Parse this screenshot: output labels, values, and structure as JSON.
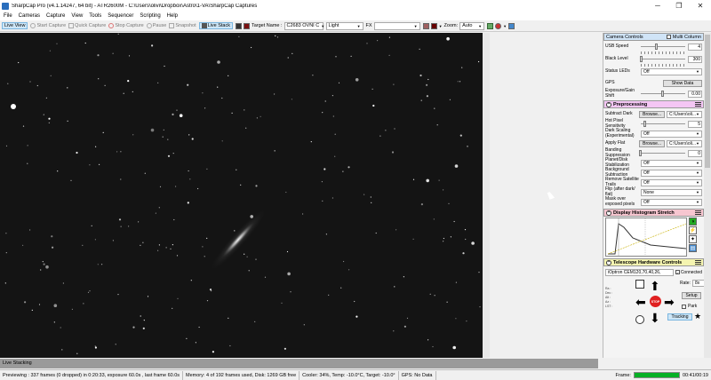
{
  "titlebar": {
    "title": "SharpCap Pro (v4.1.14247, 64 bit) - ATR2600M - C:\\Users\\olivi\\Dropbox\\Astro\\1-VA\\SharpCap Captures",
    "minimize": "─",
    "restore": "❐",
    "close": "✕"
  },
  "menu": [
    "File",
    "Cameras",
    "Capture",
    "View",
    "Tools",
    "Sequencer",
    "Scripting",
    "Help"
  ],
  "toolbar": {
    "live_view": "Live View",
    "start_capture": "Start Capture",
    "quick_capture": "Quick Capture",
    "stop_capture": "Stop Capture",
    "pause": "Pause",
    "snapshot": "Snapshot",
    "live_stack": "Live Stack",
    "target_label": "Target Name :",
    "target_value": "C2683 OVNI C",
    "frame_type": "Light",
    "fx_label": "FX",
    "fx_value": "",
    "zoom_label": "Zoom:",
    "zoom_value": "Auto"
  },
  "panel": {
    "camera_controls": {
      "title": "Camera Controls",
      "multi_column": "Multi Column",
      "usb_speed_label": "USB Speed",
      "usb_speed_value": "4",
      "usb_speed_level": 0.35,
      "black_level_label": "Black Level",
      "black_level_value": "300",
      "black_level_level": 0.02,
      "status_leds_label": "Status LEDs",
      "status_leds_value": "Off",
      "gps_label": "GPS",
      "gps_button": "Show Data",
      "exposure_gain_label": "Exposure/Gain Shift",
      "exposure_gain_value": "0.00",
      "exposure_gain_level": 0.5
    },
    "preprocessing": {
      "title": "Preprocessing",
      "subtract_dark_label": "Subtract Dark",
      "browse": "Browse...",
      "dark_path": "C:\\Users\\oli...",
      "hot_pixel_label": "Hot Pixel Sensitivity",
      "hot_pixel_value": "5",
      "hot_pixel_level": 0.1,
      "dark_scaling_label": "Dark Scaling (Experimental)",
      "dark_scaling_value": "Off",
      "apply_flat_label": "Apply Flat",
      "flat_path": "C:\\Users\\oli...",
      "banding_label": "Banding Suppression",
      "banding_value": "0",
      "banding_level": 0.0,
      "planet_label": "Planet/Disk Stabilization",
      "planet_value": "Off",
      "background_label": "Background Subtraction",
      "background_value": "Off",
      "satellite_label": "Remove Satellite Trails",
      "satellite_value": "Off",
      "flip_label": "Flip (after dark/ flat)",
      "flip_value": "None",
      "mask_label": "Mask over exposed pixels",
      "mask_value": "Off"
    },
    "histogram": {
      "title": "Display Histogram Stretch"
    },
    "telescope": {
      "title": "Telescope Hardware Controls",
      "mount": "iOptron CEM120,70,40,26,",
      "connected": "Connected",
      "rate_label": "Rate:",
      "rate_value": "8x",
      "setup": "Setup",
      "park": "Park",
      "tracking": "Tracking",
      "stop": "STOP"
    }
  },
  "status": {
    "live_stacking": "Live Stacking",
    "previewing": "Previewing : 337 frames (0 dropped) in 0:20:33, exposure 60.0s , last frame 60.0s",
    "memory": "Memory: 4 of 192 frames used, Disk: 1269 GB free",
    "cooler": "Cooler: 34%, Temp: -10.0°C, Target: -10.0°",
    "gps": "GPS: No Data",
    "frame_label": "Frame:",
    "frame_progress": 1.0,
    "time": "00:41/00:19"
  },
  "colors": {
    "preprocessing_header": "#f4c6f4",
    "histogram_header": "#f7c6d0",
    "telescope_header": "#f4f4b0",
    "camera_header": "#d0e4f7",
    "live_stack_active": "#cde6f7",
    "stop_red": "#e02020",
    "frame_green": "#06b025"
  }
}
